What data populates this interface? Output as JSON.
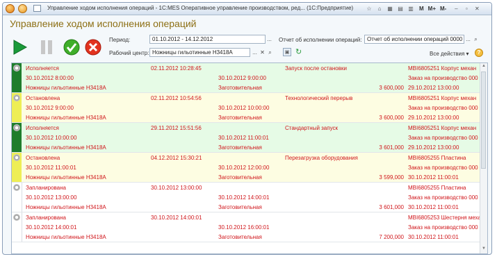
{
  "window": {
    "title": "Управление ходом исполнения операций - 1С:MES Оперативное управление производством, ред... (1С:Предприятие)",
    "toolbar_m": "M",
    "toolbar_mplus": "M+",
    "toolbar_mminus": "M-"
  },
  "page": {
    "title": "Управление ходом исполнения операций"
  },
  "filters": {
    "period_label": "Период:",
    "period_value": "01.10.2012 - 14.12.2012",
    "work_center_label": "Рабочий центр:",
    "work_center_value": "Ножницы гильотинные Н3418А",
    "report_label": "Отчет об исполнении операций:",
    "report_value": "Отчет об исполнении операций 0000",
    "ellipsis": "...",
    "all_actions": "Все действия",
    "help": "?"
  },
  "colors": {
    "executing": "#1e7d2c",
    "stopped": "#eeee55",
    "planned": "#ffffff",
    "row_executing": "#e6fbe6",
    "row_stopped": "#fdfde2",
    "text": "#d0151a"
  },
  "records": [
    {
      "status": "executing",
      "state": "Исполняется",
      "event_time": "02.11.2012 10:28:45",
      "reason": "Запуск после остановки",
      "order": "MBI6805251 Корпус механ",
      "start": "30.10.2012 8:00:00",
      "end": "30.10.2012 9:00:00",
      "plan_order": "Заказ на производство 000",
      "equipment": "Ножницы гильотинные Н3418А",
      "operation": "Заготовительная",
      "duration": "3 600,000",
      "date": "29.10.2012 13:00:00"
    },
    {
      "status": "stopped",
      "state": "Остановлена",
      "event_time": "02.11.2012 10:54:56",
      "reason": "Технологический перерыв",
      "order": "MBI6805251 Корпус механ",
      "start": "30.10.2012 9:00:00",
      "end": "30.10.2012 10:00:00",
      "plan_order": "Заказ на производство 000",
      "equipment": "Ножницы гильотинные Н3418А",
      "operation": "Заготовительная",
      "duration": "3 600,000",
      "date": "29.10.2012 13:00:00"
    },
    {
      "status": "executing",
      "state": "Исполняется",
      "event_time": "29.11.2012 15:51:56",
      "reason": "Стандартный запуск",
      "order": "MBI6805251 Корпус механ",
      "start": "30.10.2012 10:00:00",
      "end": "30.10.2012 11:00:01",
      "plan_order": "Заказ на производство 000",
      "equipment": "Ножницы гильотинные Н3418А",
      "operation": "Заготовительная",
      "duration": "3 601,000",
      "date": "29.10.2012 13:00:00"
    },
    {
      "status": "stopped",
      "state": "Остановлена",
      "event_time": "04.12.2012 15:30:21",
      "reason": "Перезагрузка оборудования",
      "order": "MBI6805255 Пластина",
      "start": "30.10.2012 11:00:01",
      "end": "30.10.2012 12:00:00",
      "plan_order": "Заказ на производство 000",
      "equipment": "Ножницы гильотинные Н3418А",
      "operation": "Заготовительная",
      "duration": "3 599,000",
      "date": "30.10.2012 11:00:01"
    },
    {
      "status": "planned",
      "state": "Запланирована",
      "event_time": "30.10.2012 13:00:00",
      "reason": "",
      "order": "MBI6805255 Пластина",
      "start": "30.10.2012 13:00:00",
      "end": "30.10.2012 14:00:01",
      "plan_order": "Заказ на производство 000",
      "equipment": "Ножницы гильотинные Н3418А",
      "operation": "Заготовительная",
      "duration": "3 601,000",
      "date": "30.10.2012 11:00:01"
    },
    {
      "status": "planned",
      "state": "Запланирована",
      "event_time": "30.10.2012 14:00:01",
      "reason": "",
      "order": "MBI6805253 Шестерня механ",
      "start": "30.10.2012 14:00:01",
      "end": "30.10.2012 16:00:01",
      "plan_order": "Заказ на производство 000",
      "equipment": "Ножницы гильотинные Н3418А",
      "operation": "Заготовительная",
      "duration": "7 200,000",
      "date": "30.10.2012 11:00:01"
    }
  ]
}
